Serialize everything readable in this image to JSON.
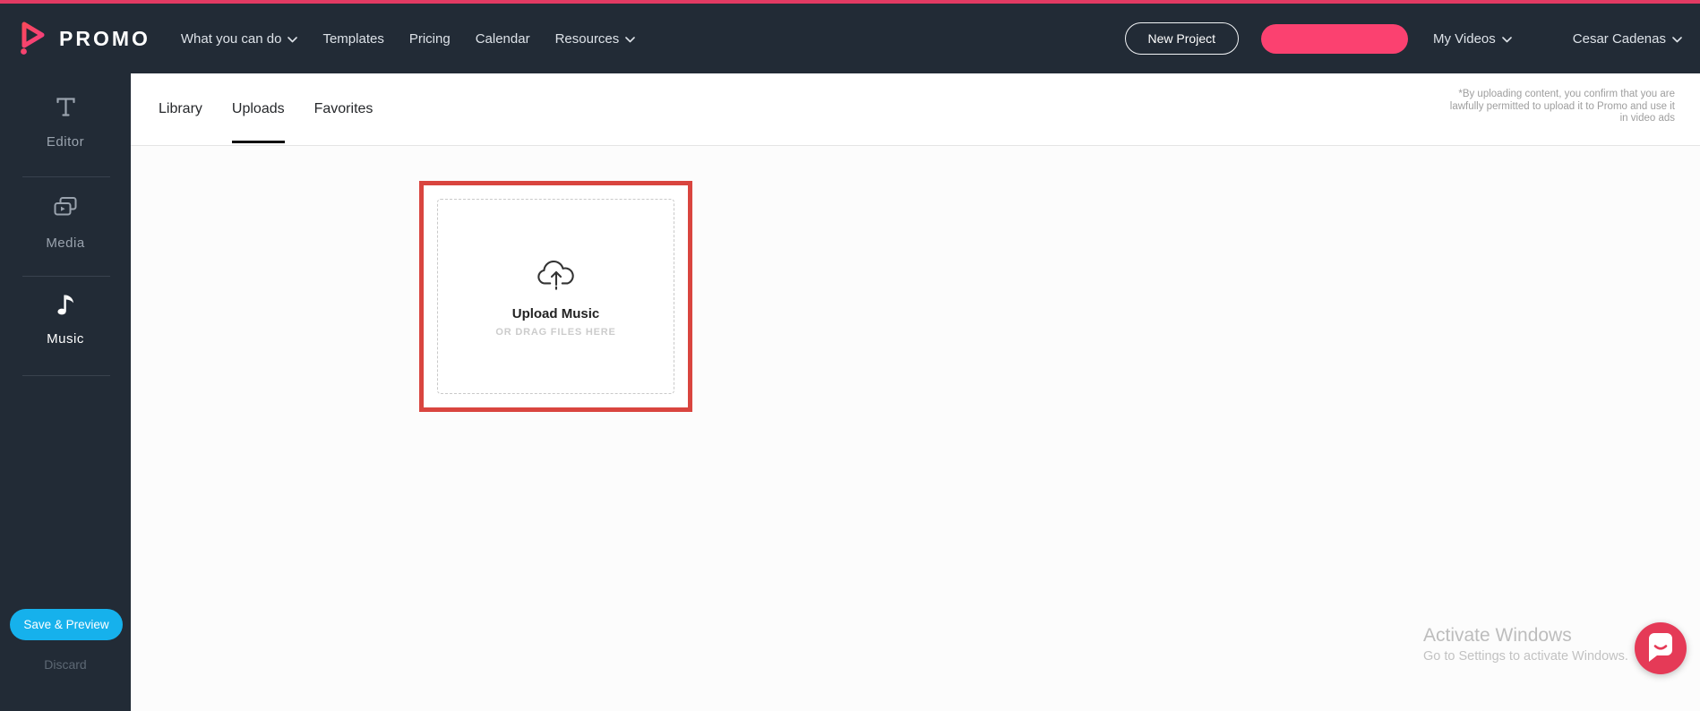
{
  "navbar": {
    "brand": "PROMO",
    "items": [
      {
        "label": "What you can do",
        "has_dropdown": true
      },
      {
        "label": "Templates",
        "has_dropdown": false
      },
      {
        "label": "Pricing",
        "has_dropdown": false
      },
      {
        "label": "Calendar",
        "has_dropdown": false
      },
      {
        "label": "Resources",
        "has_dropdown": true
      }
    ],
    "new_project_label": "New Project",
    "pink_button_label": "",
    "my_videos_label": "My Videos",
    "user_name": "Cesar Cadenas"
  },
  "sidebar": {
    "items": [
      {
        "label": "Editor",
        "icon": "text-editor-icon",
        "active": false
      },
      {
        "label": "Media",
        "icon": "media-icon",
        "active": false
      },
      {
        "label": "Music",
        "icon": "music-note-icon",
        "active": true
      }
    ],
    "save_preview_label": "Save & Preview",
    "discard_label": "Discard"
  },
  "tabs": [
    {
      "label": "Library",
      "active": false
    },
    {
      "label": "Uploads",
      "active": true
    },
    {
      "label": "Favorites",
      "active": false
    }
  ],
  "disclaimer": {
    "lines": [
      "*By uploading content, you confirm that you are",
      "lawfully permitted to upload it to Promo and use it",
      "in video ads"
    ]
  },
  "upload": {
    "icon": "cloud-upload-icon",
    "title": "Upload Music",
    "subtitle": "OR DRAG FILES HERE"
  },
  "watermark": {
    "line1": "Activate Windows",
    "line2": "Go to Settings to activate Windows."
  },
  "colors": {
    "top_strip": "#e23a63",
    "dark_bg": "#222b36",
    "accent_pink": "#fb4170",
    "save_blue": "#16b1ec",
    "upload_border_red": "#d9453f",
    "chat_red": "#e53a57"
  }
}
